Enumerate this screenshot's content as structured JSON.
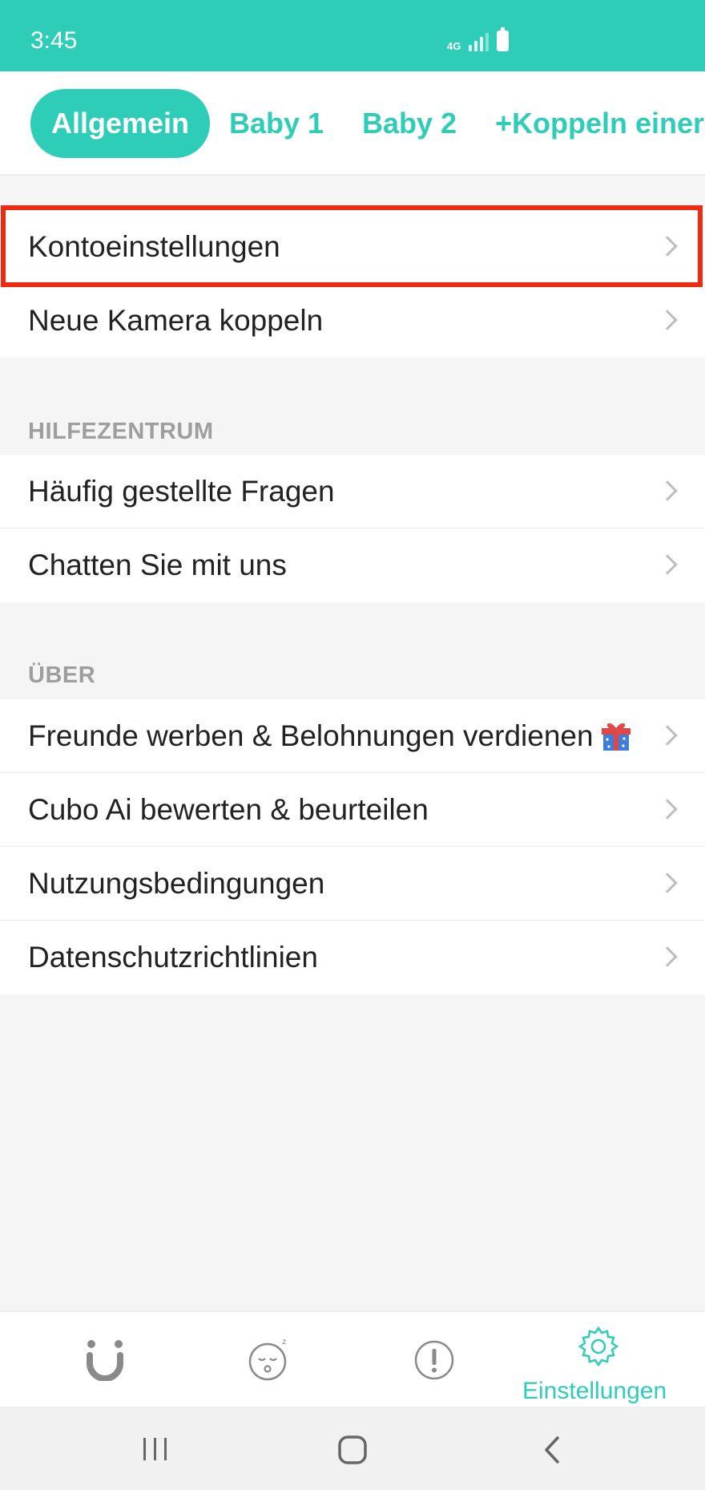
{
  "status_bar": {
    "time": "3:45",
    "network": "4G"
  },
  "tabs": [
    {
      "label": "Allgemein",
      "active": true
    },
    {
      "label": "Baby 1",
      "active": false
    },
    {
      "label": "Baby 2",
      "active": false
    },
    {
      "label": "+Koppeln einer",
      "active": false
    }
  ],
  "account_section": {
    "items": [
      {
        "label": "Kontoeinstellungen",
        "highlighted": true
      },
      {
        "label": "Neue Kamera koppeln"
      }
    ]
  },
  "help_section": {
    "header": "HILFEZENTRUM",
    "items": [
      {
        "label": "Häufig gestellte Fragen"
      },
      {
        "label": "Chatten Sie mit uns"
      }
    ]
  },
  "about_section": {
    "header": "ÜBER",
    "items": [
      {
        "label": "Freunde werben & Belohnungen verdienen",
        "icon": "gift-icon"
      },
      {
        "label": "Cubo Ai bewerten & beurteilen"
      },
      {
        "label": "Nutzungsbedingungen"
      },
      {
        "label": "Datenschutzrichtlinien"
      }
    ]
  },
  "bottom_nav": {
    "items": [
      {
        "icon": "cubo-logo-icon"
      },
      {
        "icon": "sleeping-face-icon"
      },
      {
        "icon": "alert-icon"
      },
      {
        "icon": "gear-icon",
        "label": "Einstellungen",
        "active": true
      }
    ]
  },
  "colors": {
    "accent": "#2ecdb7",
    "highlight": "#f02a10",
    "background": "#f5f5f5"
  }
}
